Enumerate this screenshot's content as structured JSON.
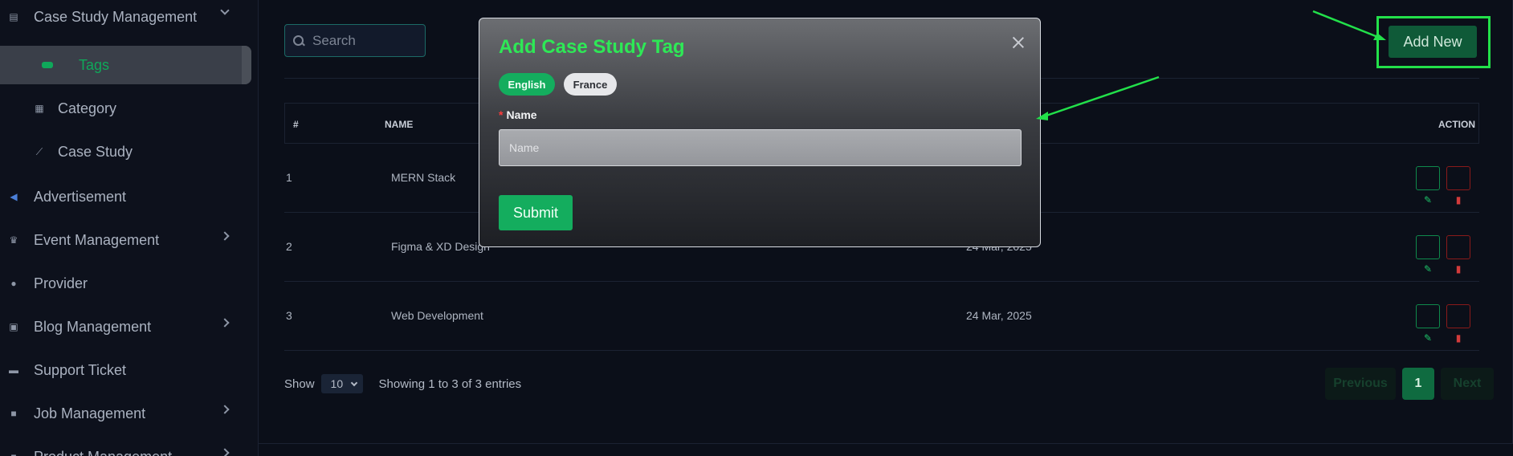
{
  "sidebar": {
    "items": [
      {
        "label": "Case Study Management",
        "icon": "document-icon"
      },
      {
        "label": "Tags",
        "icon": "tag-icon"
      },
      {
        "label": "Category",
        "icon": "grid-icon"
      },
      {
        "label": "Case Study",
        "icon": "chart-line-icon"
      },
      {
        "label": "Advertisement",
        "icon": "megaphone-icon"
      },
      {
        "label": "Event Management",
        "icon": "trophy-icon"
      },
      {
        "label": "Provider",
        "icon": "user-icon"
      },
      {
        "label": "Blog Management",
        "icon": "blog-icon"
      },
      {
        "label": "Support Ticket",
        "icon": "ticket-icon"
      },
      {
        "label": "Job Management",
        "icon": "briefcase-icon"
      },
      {
        "label": "Product Management",
        "icon": "box-icon"
      }
    ]
  },
  "toolbar": {
    "search_placeholder": "Search",
    "add_new_label": "Add New"
  },
  "table": {
    "headers": {
      "index": "#",
      "name": "NAME",
      "action": "ACTION"
    },
    "rows": [
      {
        "index": "1",
        "name": "MERN Stack",
        "date": ""
      },
      {
        "index": "2",
        "name": "Figma & XD Design",
        "date": "24 Mar, 2025"
      },
      {
        "index": "3",
        "name": "Web Development",
        "date": "24 Mar, 2025"
      }
    ]
  },
  "footer": {
    "show_label": "Show",
    "page_size": "10",
    "entries_text": "Showing 1 to 3 of 3 entries",
    "prev_label": "Previous",
    "current_page": "1",
    "next_label": "Next"
  },
  "modal": {
    "title": "Add Case Study Tag",
    "languages": [
      "English",
      "France"
    ],
    "field_label": "Name",
    "field_placeholder": "Name",
    "submit_label": "Submit"
  },
  "colors": {
    "accent": "#14ad5e",
    "highlight": "#22e04a",
    "danger": "#d23b3b"
  }
}
